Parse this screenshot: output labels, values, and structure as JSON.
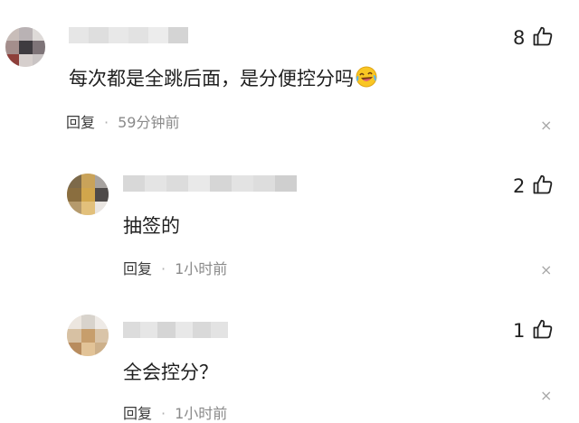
{
  "comments": [
    {
      "text": "每次都是全跳后面，是分便控分吗",
      "reply_label": "回复",
      "time": "59分钟前",
      "likes": "8",
      "emoji": "laughing-crying-emoji",
      "close_glyph": "×"
    },
    {
      "text": "抽签的",
      "reply_label": "回复",
      "time": "1小时前",
      "likes": "2",
      "close_glyph": "×"
    },
    {
      "text": "全会控分？",
      "reply_label": "回复",
      "time": "1小时前",
      "likes": "1",
      "close_glyph": "×"
    }
  ],
  "separator": "·",
  "icons": {
    "like": "thumbs-up-icon",
    "close": "close-icon"
  }
}
